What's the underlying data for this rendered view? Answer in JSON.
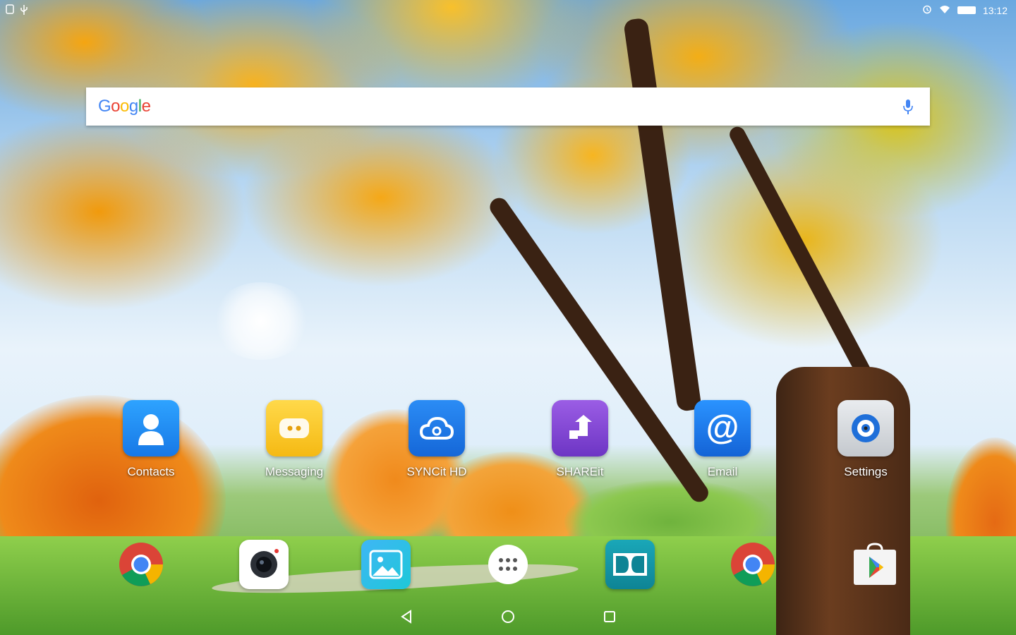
{
  "status_bar": {
    "left_icons": [
      "sim-icon",
      "usb-icon"
    ],
    "right_icons": [
      "alarm-icon",
      "wifi-icon",
      "battery-icon"
    ],
    "time": "13:12"
  },
  "search": {
    "logo_letters": [
      {
        "char": "G",
        "color": "#4285F4"
      },
      {
        "char": "o",
        "color": "#EA4335"
      },
      {
        "char": "o",
        "color": "#FBBC05"
      },
      {
        "char": "g",
        "color": "#4285F4"
      },
      {
        "char": "l",
        "color": "#34A853"
      },
      {
        "char": "e",
        "color": "#EA4335"
      }
    ],
    "mic_icon": "mic-icon"
  },
  "apps": [
    {
      "label": "Contacts",
      "icon": "contacts-icon",
      "color": "#1E88F0"
    },
    {
      "label": "Messaging",
      "icon": "messaging-icon",
      "color": "#F7C51E"
    },
    {
      "label": "SYNCit HD",
      "icon": "cloud-sync-icon",
      "color": "#1A73E8"
    },
    {
      "label": "SHAREit",
      "icon": "shareit-icon",
      "color": "#8E44D8"
    },
    {
      "label": "Email",
      "icon": "email-icon",
      "color": "#1E7FE8"
    },
    {
      "label": "Settings",
      "icon": "settings-icon",
      "color": "#D9DCE0"
    }
  ],
  "dock": [
    {
      "name": "chrome-icon"
    },
    {
      "name": "camera-icon"
    },
    {
      "name": "gallery-icon"
    },
    {
      "name": "app-drawer-icon"
    },
    {
      "name": "dolby-icon"
    },
    {
      "name": "chrome-icon"
    },
    {
      "name": "play-store-icon"
    }
  ],
  "navigation": [
    "back-icon",
    "home-icon",
    "recents-icon"
  ]
}
